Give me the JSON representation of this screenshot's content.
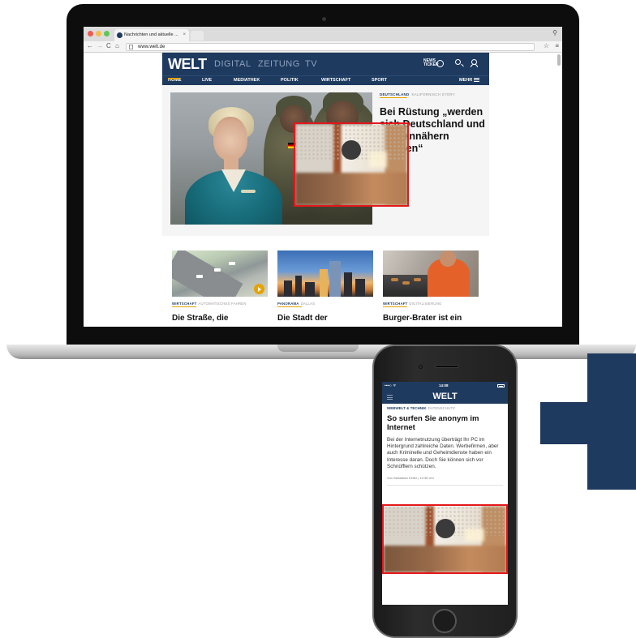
{
  "browser": {
    "tab_title": "Nachrichten und aktuelle ...",
    "tab_close": "×",
    "url": "www.welt.de",
    "back": "←",
    "forward": "→",
    "reload": "C",
    "home": "⌂"
  },
  "desktop": {
    "logo": "WELT",
    "nav": [
      "DIGITAL",
      "ZEITUNG",
      "TV"
    ],
    "news_label_1": "NEWS",
    "news_label_2": "TICKER",
    "subnav": [
      "HOME",
      "LIVE",
      "MEDIATHEK",
      "POLITIK",
      "WIRTSCHAFT",
      "SPORT"
    ],
    "subnav_more": "MEHR",
    "hero": {
      "kicker": "DEUTSCHLAND",
      "kicker_sub": "KALIFORNISCH STORY",
      "headline": "Bei Rüstung „werden sich Deutschland und USA annähern müssen“"
    },
    "teasers": [
      {
        "kicker": "WIRTSCHAFT",
        "kicker_sub": "AUTOMATISCHES FAHREN",
        "title": "Die Straße, die"
      },
      {
        "kicker": "PANORAMA",
        "kicker_sub": "DALLAS",
        "title": "Die Stadt der"
      },
      {
        "kicker": "WIRTSCHAFT",
        "kicker_sub": "DIGITALISIERUNG",
        "title": "Burger-Brater ist ein"
      }
    ]
  },
  "mobile": {
    "carrier": "••••○ ᯤ",
    "time": "14:08",
    "logo": "WELT",
    "kicker": "WEBWELT & TECHNIK",
    "kicker_sub": "DATENSCHUTZ",
    "title": "So surfen Sie anonym im Internet",
    "text": "Bei der Internetnutzung überträgt Ihr PC im Hintergrund zahlreiche Daten. Werbefirmen, aber auch Kriminelle und Geheimdienste haben ein Interesse daran. Doch Sie können sich vor Schnüfflern schützen.",
    "author": "Von Sebastian Keller | 10:35 Uhr"
  },
  "colors": {
    "brand_navy": "#1e3a5f",
    "accent_gold": "#e6a200",
    "highlight_red": "#e4171b"
  }
}
